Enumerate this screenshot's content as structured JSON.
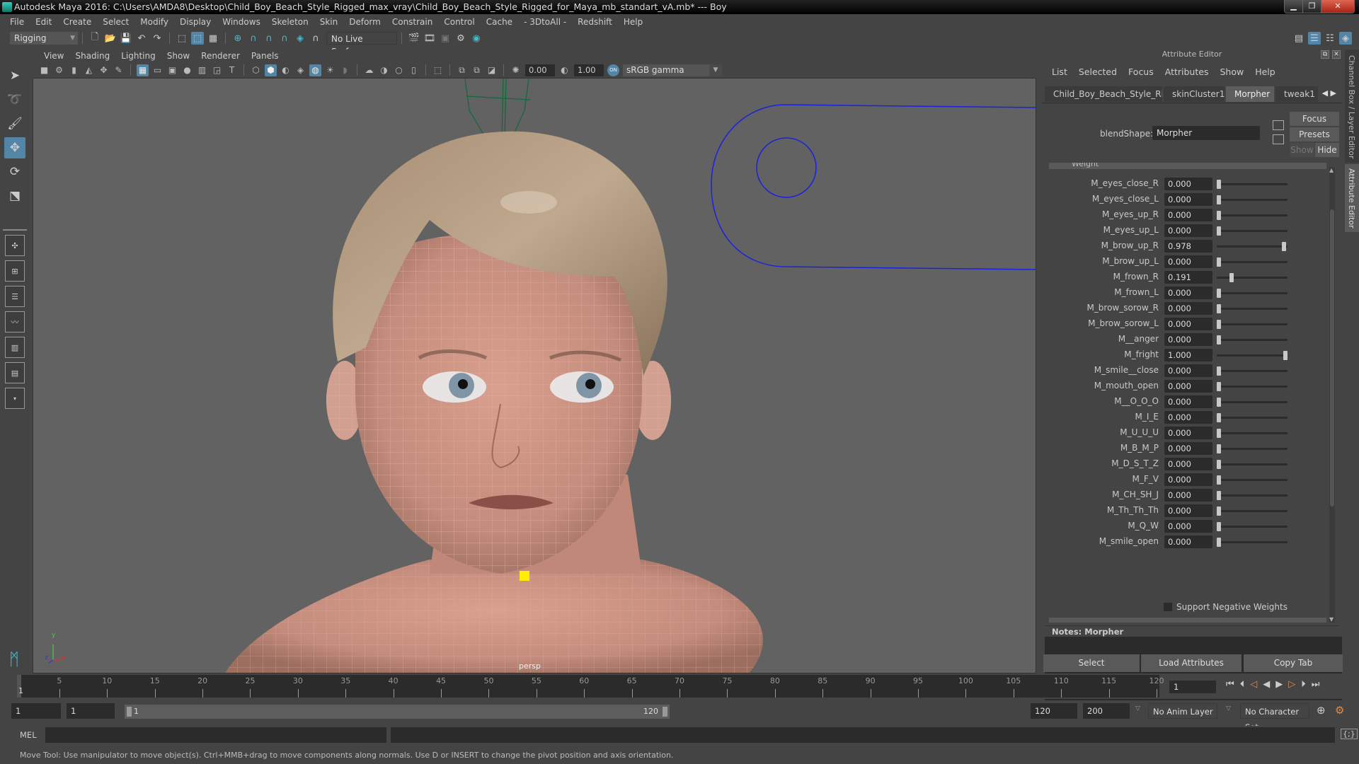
{
  "window": {
    "title": "Autodesk Maya 2016: C:\\Users\\AMDA8\\Desktop\\Child_Boy_Beach_Style_Rigged_max_vray\\Child_Boy_Beach_Style_Rigged_for_Maya_mb_standart_vA.mb*   ---   Boy",
    "minimize": "▁",
    "restore": "❐",
    "close": "✕"
  },
  "menubar": [
    "File",
    "Edit",
    "Create",
    "Select",
    "Modify",
    "Display",
    "Windows",
    "Skeleton",
    "Skin",
    "Deform",
    "Constrain",
    "Control",
    "Cache",
    "- 3DtoAll -",
    "Redshift",
    "Help"
  ],
  "statusline": {
    "menuset": "Rigging",
    "live_surface": "No Live Surface"
  },
  "viewport": {
    "menus": [
      "View",
      "Shading",
      "Lighting",
      "Show",
      "Renderer",
      "Panels"
    ],
    "exposure": "0.00",
    "gamma": "1.00",
    "color_space": "sRGB gamma",
    "camera_label": "persp",
    "axis": {
      "y": "y",
      "z": "z",
      "x": "x"
    }
  },
  "attribute_editor": {
    "title": "Attribute Editor",
    "menus": [
      "List",
      "Selected",
      "Focus",
      "Attributes",
      "Show",
      "Help"
    ],
    "tabs": [
      {
        "label": "Child_Boy_Beach_Style_Rigged",
        "active": false
      },
      {
        "label": "skinCluster1",
        "active": false
      },
      {
        "label": "Morpher",
        "active": true
      },
      {
        "label": "tweak1",
        "active": false
      }
    ],
    "node_type_label": "blendShape:",
    "node_name": "Morpher",
    "focus_btn": "Focus",
    "presets_btn": "Presets",
    "show_btn": "Show",
    "hide_btn": "Hide",
    "section_label": "Weight",
    "weights": [
      {
        "name": "M_eyes_close_R",
        "value": "0.000",
        "fraction": 0.0
      },
      {
        "name": "M_eyes_close_L",
        "value": "0.000",
        "fraction": 0.0
      },
      {
        "name": "M_eyes_up_R",
        "value": "0.000",
        "fraction": 0.0
      },
      {
        "name": "M_eyes_up_L",
        "value": "0.000",
        "fraction": 0.0
      },
      {
        "name": "M_brow_up_R",
        "value": "0.978",
        "fraction": 0.978
      },
      {
        "name": "M_brow_up_L",
        "value": "0.000",
        "fraction": 0.0
      },
      {
        "name": "M_frown_R",
        "value": "0.191",
        "fraction": 0.191
      },
      {
        "name": "M_frown_L",
        "value": "0.000",
        "fraction": 0.0
      },
      {
        "name": "M_brow_sorow_R",
        "value": "0.000",
        "fraction": 0.0
      },
      {
        "name": "M_brow_sorow_L",
        "value": "0.000",
        "fraction": 0.0
      },
      {
        "name": "M__anger",
        "value": "0.000",
        "fraction": 0.0
      },
      {
        "name": "M_fright",
        "value": "1.000",
        "fraction": 1.0
      },
      {
        "name": "M_smile__close",
        "value": "0.000",
        "fraction": 0.0
      },
      {
        "name": "M_mouth_open",
        "value": "0.000",
        "fraction": 0.0
      },
      {
        "name": "M__O_O_O",
        "value": "0.000",
        "fraction": 0.0
      },
      {
        "name": "M_I_E",
        "value": "0.000",
        "fraction": 0.0
      },
      {
        "name": "M_U_U_U",
        "value": "0.000",
        "fraction": 0.0
      },
      {
        "name": "M_B_M_P",
        "value": "0.000",
        "fraction": 0.0
      },
      {
        "name": "M_D_S_T_Z",
        "value": "0.000",
        "fraction": 0.0
      },
      {
        "name": "M_F_V",
        "value": "0.000",
        "fraction": 0.0
      },
      {
        "name": "M_CH_SH_J",
        "value": "0.000",
        "fraction": 0.0
      },
      {
        "name": "M_Th_Th_Th",
        "value": "0.000",
        "fraction": 0.0
      },
      {
        "name": "M_Q_W",
        "value": "0.000",
        "fraction": 0.0
      },
      {
        "name": "M_smile_open",
        "value": "0.000",
        "fraction": 0.0
      }
    ],
    "support_negative_weights": "Support Negative Weights",
    "notes_label": "Notes:  Morpher",
    "notes_value": "",
    "select_btn": "Select",
    "load_btn": "Load Attributes",
    "copy_btn": "Copy Tab",
    "side_tabs": {
      "channel_box": "Channel Box / Layer Editor",
      "attribute_editor": "Attribute Editor"
    }
  },
  "timeline": {
    "ticks": [
      "5",
      "10",
      "15",
      "20",
      "25",
      "30",
      "35",
      "40",
      "45",
      "50",
      "55",
      "60",
      "65",
      "70",
      "75",
      "80",
      "85",
      "90",
      "95",
      "100",
      "105",
      "110",
      "115",
      "120"
    ],
    "current_frame_marker": "1",
    "current_frame": "1"
  },
  "range": {
    "start": "1",
    "playback_start": "1",
    "slider_start": "1",
    "slider_end": "120",
    "playback_end": "120",
    "end": "200",
    "anim_layer": "No Anim Layer",
    "character_set": "No Character Set"
  },
  "cmdline": {
    "label": "MEL",
    "value": ""
  },
  "helpline": "Move Tool: Use manipulator to move object(s). Ctrl+MMB+drag to move components along normals. Use D or INSERT to change the pivot position and axis orientation."
}
